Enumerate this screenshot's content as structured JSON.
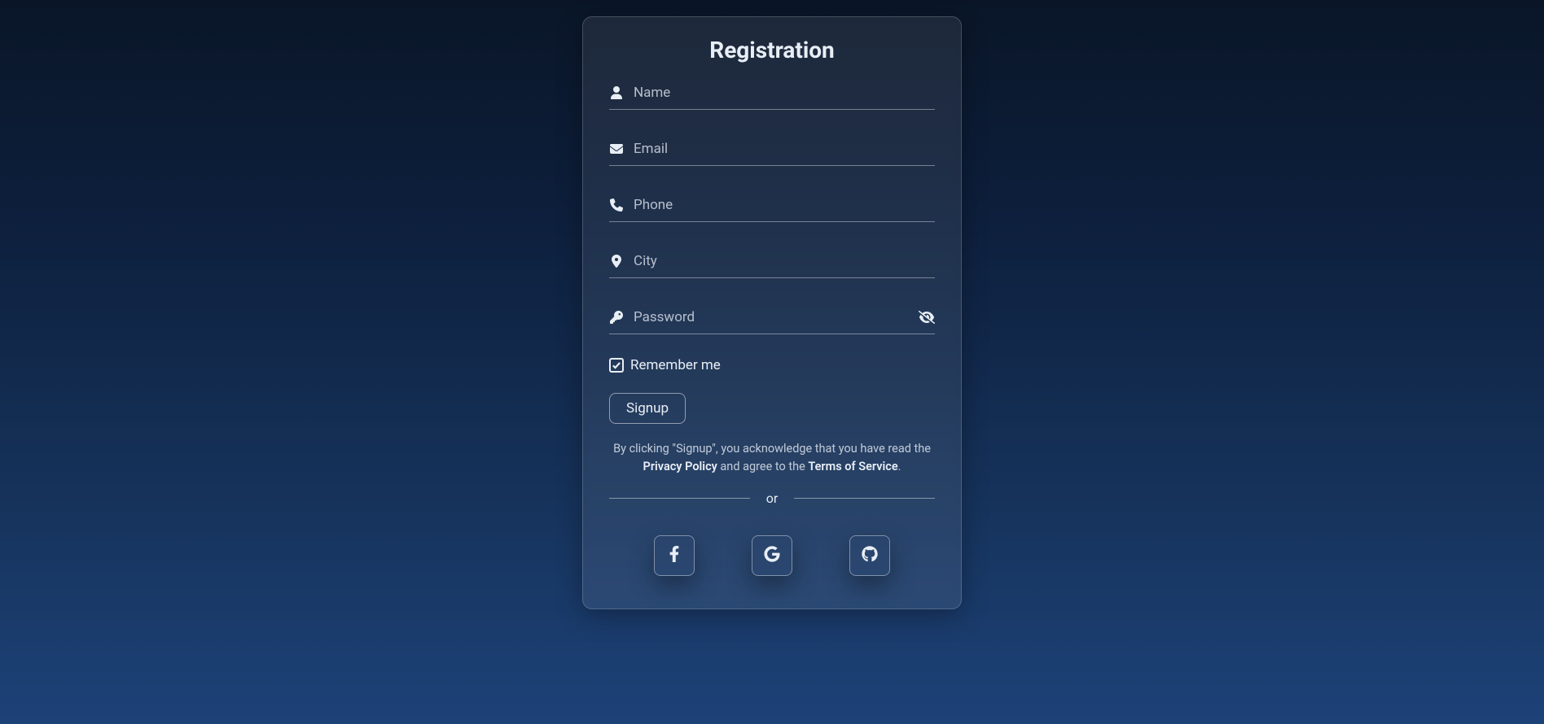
{
  "title": "Registration",
  "fields": {
    "name": {
      "placeholder": "Name",
      "value": ""
    },
    "email": {
      "placeholder": "Email",
      "value": ""
    },
    "phone": {
      "placeholder": "Phone",
      "value": ""
    },
    "city": {
      "placeholder": "City",
      "value": ""
    },
    "password": {
      "placeholder": "Password",
      "value": ""
    }
  },
  "remember": {
    "label": "Remember me",
    "checked": true
  },
  "signup_button": "Signup",
  "disclaimer": {
    "text_before": "By clicking \"Signup\", you acknowledge that you have read the ",
    "privacy_link": "Privacy Policy",
    "text_middle": " and agree to the ",
    "terms_link": "Terms of Service",
    "text_after": "."
  },
  "divider": "or",
  "social": {
    "facebook": "facebook",
    "google": "google",
    "github": "github"
  }
}
